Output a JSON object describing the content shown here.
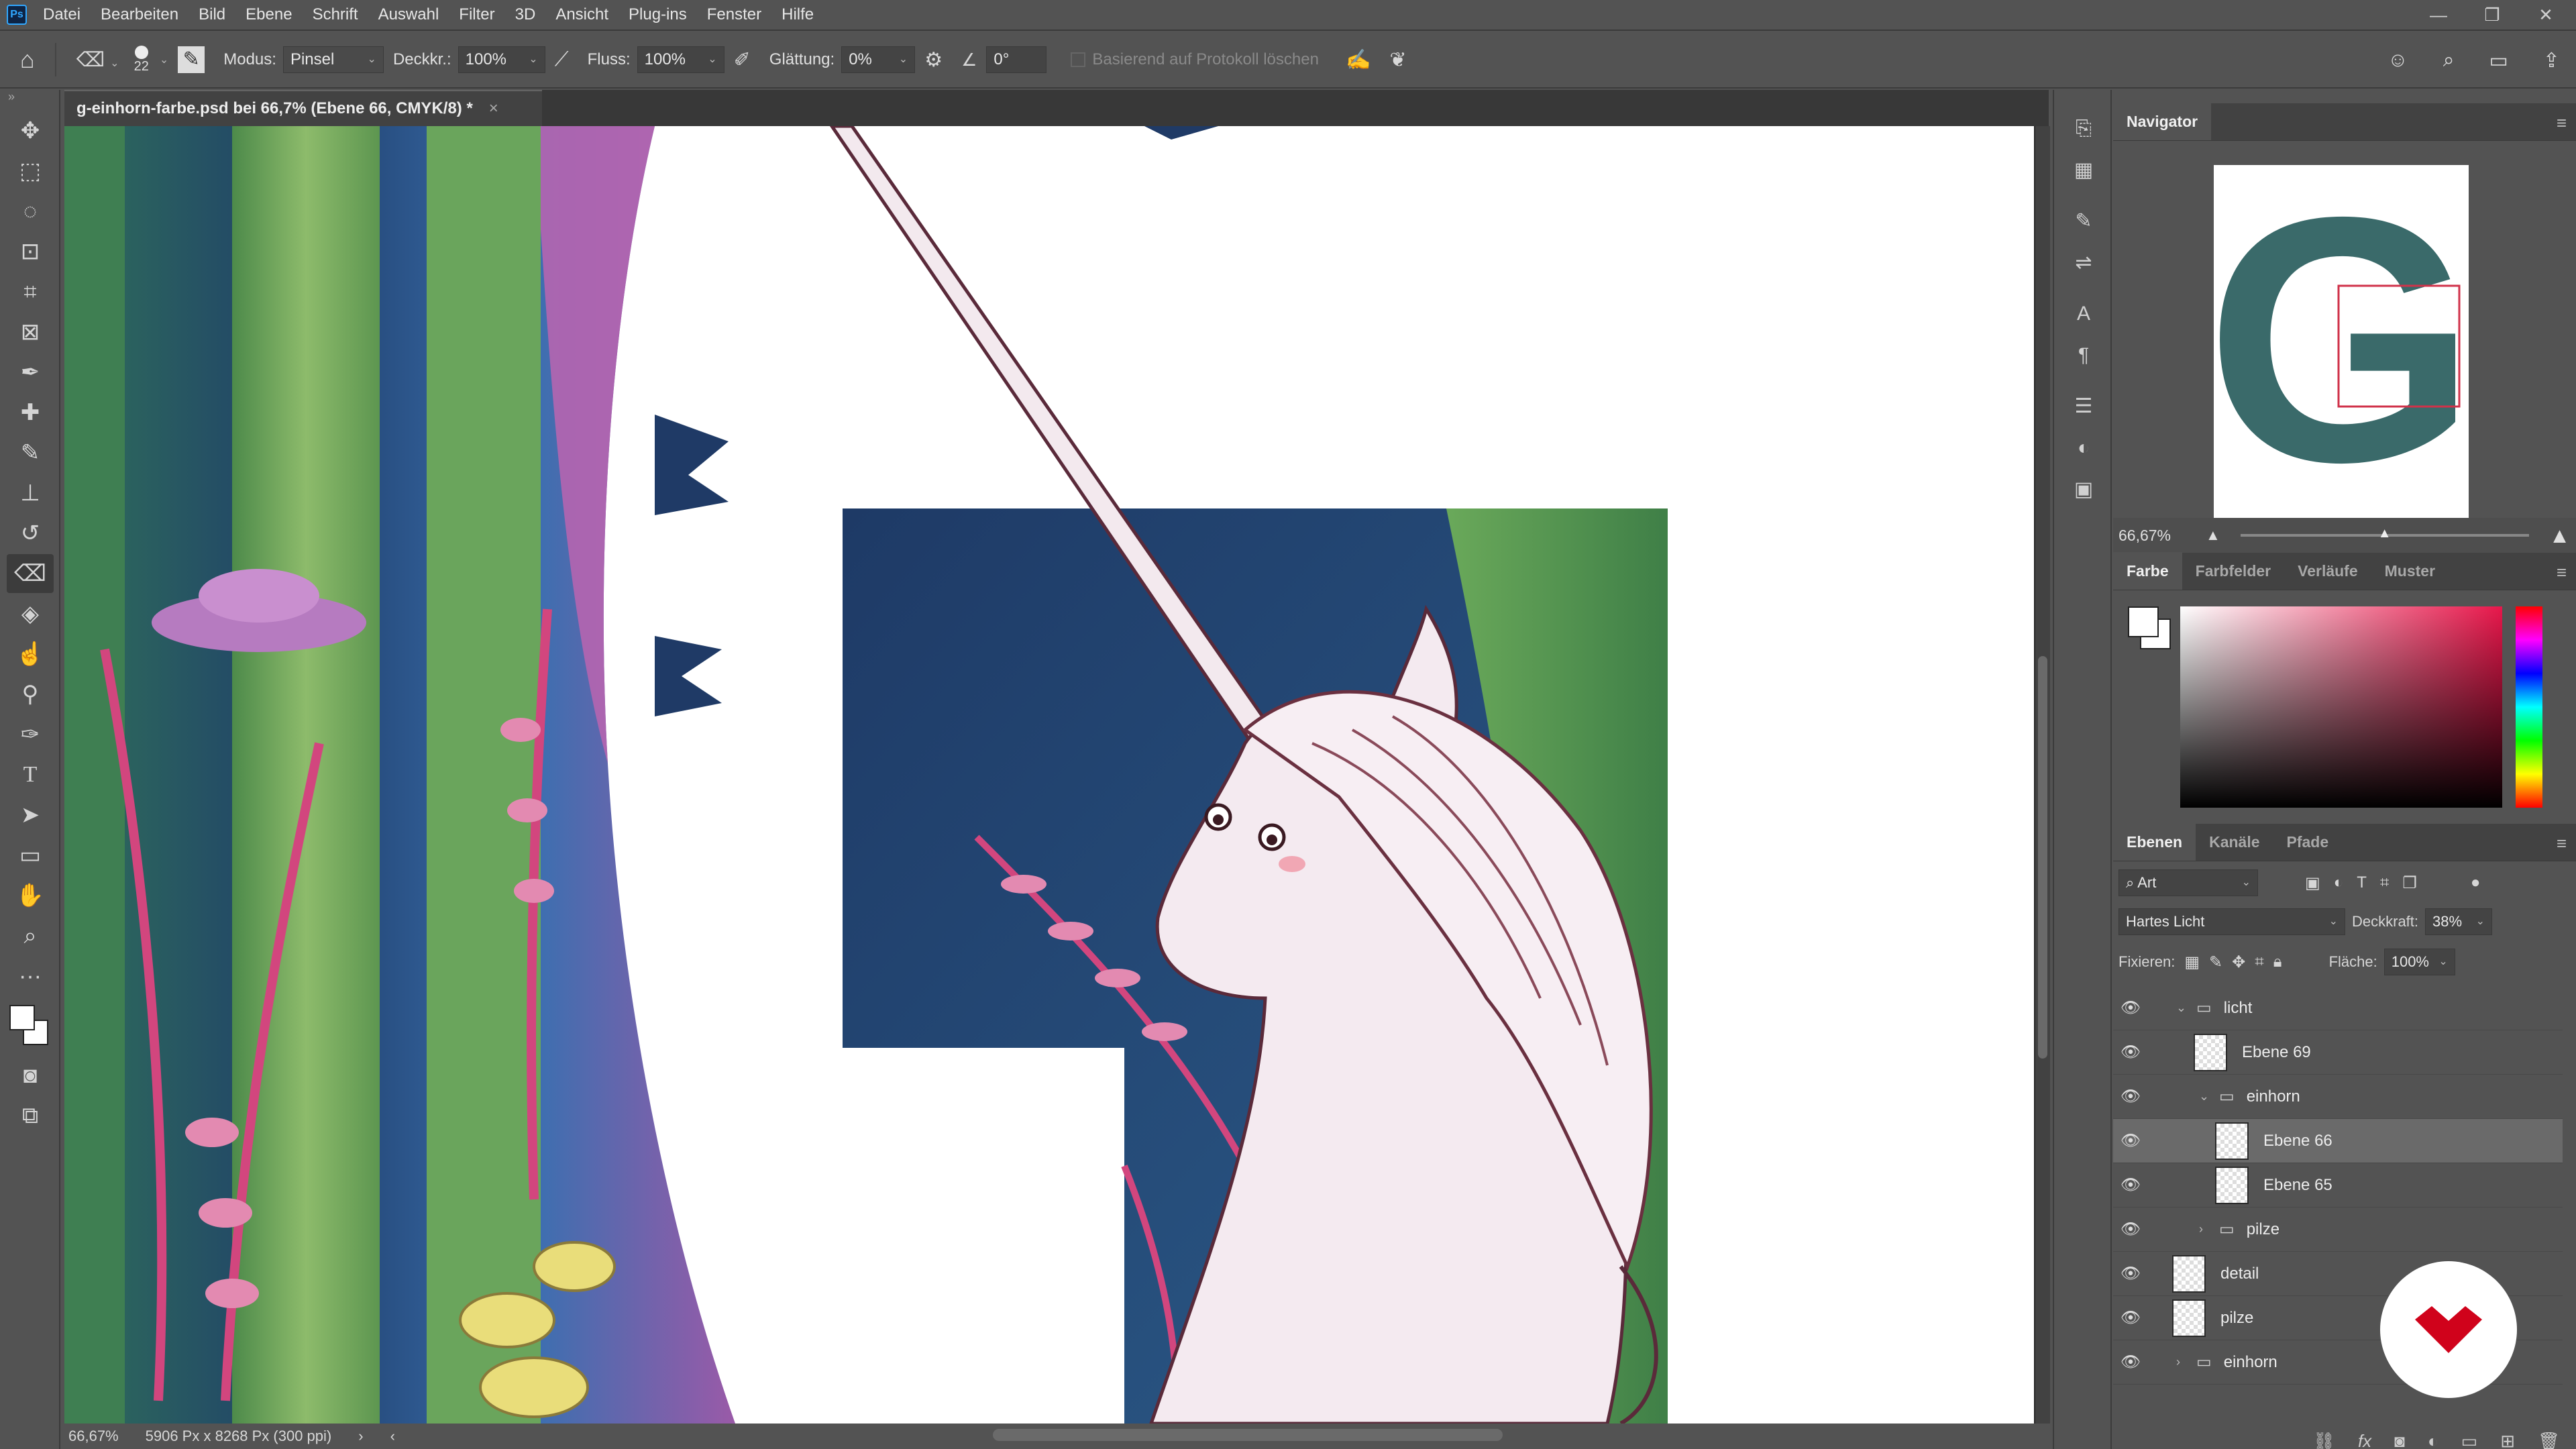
{
  "menubar": {
    "items": [
      "Datei",
      "Bearbeiten",
      "Bild",
      "Ebene",
      "Schrift",
      "Auswahl",
      "Filter",
      "3D",
      "Ansicht",
      "Plug-ins",
      "Fenster",
      "Hilfe"
    ]
  },
  "options": {
    "brush_size": "22",
    "mode_label": "Modus:",
    "mode_value": "Pinsel",
    "opacity_label": "Deckkr.:",
    "opacity_value": "100%",
    "flow_label": "Fluss:",
    "flow_value": "100%",
    "smoothing_label": "Glättung:",
    "smoothing_value": "0%",
    "angle_value": "0°",
    "history_label": "Basierend auf Protokoll löschen"
  },
  "document": {
    "tab_title": "g-einhorn-farbe.psd bei 66,7% (Ebene 66, CMYK/8) *"
  },
  "status": {
    "zoom": "66,67%",
    "doc_info": "5906 Px x 8268 Px (300 ppi)"
  },
  "navigator": {
    "tab": "Navigator",
    "zoom": "66,67%",
    "preview_letter": "G"
  },
  "color_panel": {
    "tabs": [
      "Farbe",
      "Farbfelder",
      "Verläufe",
      "Muster"
    ],
    "hue_color": "#e8174b"
  },
  "layers_panel": {
    "tabs": [
      "Ebenen",
      "Kanäle",
      "Pfade"
    ],
    "filter_label": "Art",
    "blend_mode": "Hartes Licht",
    "opacity_label": "Deckkraft:",
    "opacity_value": "38%",
    "lock_label": "Fixieren:",
    "fill_label": "Fläche:",
    "fill_value": "100%",
    "layers": [
      {
        "name": "licht",
        "type": "group",
        "expanded": true
      },
      {
        "name": "Ebene 69",
        "type": "layer"
      },
      {
        "name": "einhorn",
        "type": "group",
        "expanded": true
      },
      {
        "name": "Ebene 66",
        "type": "layer",
        "selected": true
      },
      {
        "name": "Ebene 65",
        "type": "layer"
      },
      {
        "name": "pilze",
        "type": "group",
        "expanded": false
      },
      {
        "name": "detail",
        "type": "layer"
      },
      {
        "name": "pilze",
        "type": "layer"
      },
      {
        "name": "einhorn",
        "type": "group",
        "expanded": false
      }
    ]
  },
  "colors": {
    "ui_bg": "#535353",
    "panel_dark": "#424242",
    "accent_logo": "#d0021b"
  }
}
